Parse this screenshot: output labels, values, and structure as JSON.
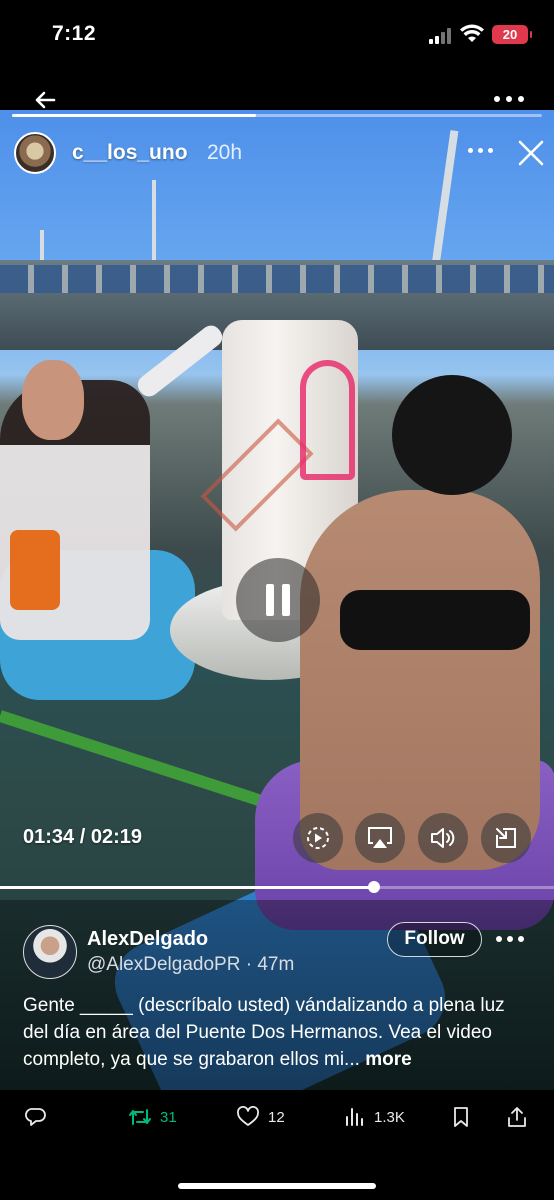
{
  "status_bar": {
    "time": "7:12",
    "battery": "20"
  },
  "story": {
    "username": "c__los_uno",
    "age": "20h"
  },
  "video": {
    "current_time": "01:34",
    "separator": " / ",
    "duration": "02:19",
    "progress": 0.675
  },
  "tweet": {
    "author_name": "AlexDelgado",
    "author_handle": "@AlexDelgadoPR",
    "dot": " · ",
    "posted": "47m",
    "follow_label": "Follow",
    "text": "Gente _____ (descríbalo usted) vándalizando a plena luz del día en área del Puente Dos Hermanos. Vea el video completo, ya que se grabaron ellos mi... ",
    "more_label": "more"
  },
  "actions": {
    "retweets": "31",
    "likes": "12",
    "views": "1.3K"
  },
  "colors": {
    "retweet_green": "#00ba7c",
    "battery_red": "#e0384c",
    "background": "#000000"
  },
  "icons": [
    "back-arrow-icon",
    "more-icon",
    "close-icon",
    "pause-icon",
    "replay-speed-icon",
    "airplay-icon",
    "volume-icon",
    "pip-icon",
    "reply-icon",
    "retweet-icon",
    "like-icon",
    "views-icon",
    "bookmark-icon",
    "share-icon"
  ]
}
